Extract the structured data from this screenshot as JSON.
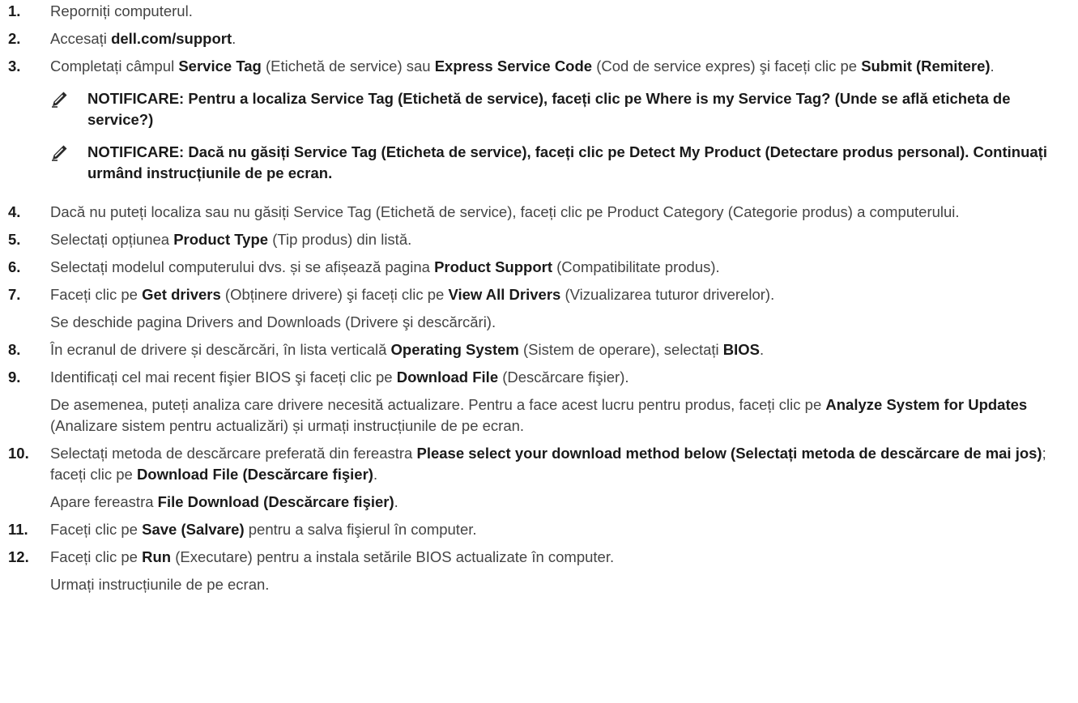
{
  "steps": [
    {
      "num": "1.",
      "parts": [
        {
          "t": "Reporniți computerul."
        }
      ]
    },
    {
      "num": "2.",
      "parts": [
        {
          "t": "Accesați "
        },
        {
          "t": "dell.com/support",
          "b": true
        },
        {
          "t": "."
        }
      ]
    },
    {
      "num": "3.",
      "parts": [
        {
          "t": "Completați câmpul "
        },
        {
          "t": "Service Tag",
          "b": true
        },
        {
          "t": " (Etichetă de service) sau "
        },
        {
          "t": "Express Service Code",
          "b": true
        },
        {
          "t": " (Cod de service expres) şi faceți clic pe "
        },
        {
          "t": "Submit (Remitere)",
          "b": true
        },
        {
          "t": "."
        }
      ],
      "notes": [
        "NOTIFICARE: Pentru a localiza Service Tag (Etichetă de service), faceți clic pe Where is my Service Tag? (Unde se află eticheta de service?)",
        "NOTIFICARE: Dacă nu găsiți Service Tag (Eticheta de service), faceți clic pe Detect My Product (Detectare produs personal). Continuați urmând instrucțiunile de pe ecran."
      ]
    },
    {
      "num": "4.",
      "parts": [
        {
          "t": "Dacă nu puteți localiza sau nu găsiți Service Tag (Etichetă de service), faceți clic pe Product Category (Categorie produs) a computerului."
        }
      ]
    },
    {
      "num": "5.",
      "parts": [
        {
          "t": "Selectați opțiunea "
        },
        {
          "t": "Product Type",
          "b": true
        },
        {
          "t": " (Tip produs) din listă."
        }
      ]
    },
    {
      "num": "6.",
      "parts": [
        {
          "t": "Selectați modelul computerului dvs. și se afișează pagina "
        },
        {
          "t": "Product Support",
          "b": true
        },
        {
          "t": " (Compatibilitate produs)."
        }
      ]
    },
    {
      "num": "7.",
      "parts": [
        {
          "t": "Faceți clic pe "
        },
        {
          "t": "Get drivers",
          "b": true
        },
        {
          "t": " (Obținere drivere) şi faceți clic pe "
        },
        {
          "t": "View All Drivers",
          "b": true
        },
        {
          "t": " (Vizualizarea tuturor driverelor)."
        }
      ],
      "sub": [
        [
          {
            "t": "Se deschide pagina Drivers and Downloads (Drivere şi descărcări)."
          }
        ]
      ]
    },
    {
      "num": "8.",
      "parts": [
        {
          "t": "În ecranul de drivere și descărcări, în lista verticală "
        },
        {
          "t": "Operating System",
          "b": true
        },
        {
          "t": " (Sistem de operare), selectați "
        },
        {
          "t": "BIOS",
          "b": true
        },
        {
          "t": "."
        }
      ]
    },
    {
      "num": "9.",
      "parts": [
        {
          "t": "Identificați cel mai recent fişier BIOS şi faceți clic pe "
        },
        {
          "t": "Download File",
          "b": true
        },
        {
          "t": " (Descărcare fişier)."
        }
      ],
      "sub": [
        [
          {
            "t": "De asemenea, puteți analiza care drivere necesită actualizare. Pentru a face acest lucru pentru produs, faceți clic pe "
          },
          {
            "t": "Analyze System for Updates",
            "b": true
          },
          {
            "t": " (Analizare sistem pentru actualizări) și urmați instrucțiunile de pe ecran."
          }
        ]
      ]
    },
    {
      "num": "10.",
      "parts": [
        {
          "t": "Selectați metoda de descărcare preferată din fereastra "
        },
        {
          "t": "Please select your download method below (Selectați metoda de descărcare de mai jos)",
          "b": true
        },
        {
          "t": "; faceți clic pe "
        },
        {
          "t": "Download File (Descărcare fişier)",
          "b": true
        },
        {
          "t": "."
        }
      ],
      "sub": [
        [
          {
            "t": "Apare fereastra "
          },
          {
            "t": "File Download (Descărcare fişier)",
            "b": true
          },
          {
            "t": "."
          }
        ]
      ]
    },
    {
      "num": "11.",
      "parts": [
        {
          "t": "Faceți clic pe "
        },
        {
          "t": "Save (Salvare)",
          "b": true
        },
        {
          "t": " pentru a salva fişierul în computer."
        }
      ]
    },
    {
      "num": "12.",
      "parts": [
        {
          "t": "Faceți clic pe "
        },
        {
          "t": "Run",
          "b": true
        },
        {
          "t": " (Executare) pentru a instala setările BIOS actualizate în computer."
        }
      ],
      "sub": [
        [
          {
            "t": "Urmați instrucțiunile de pe ecran."
          }
        ]
      ]
    }
  ],
  "note_icon": "pencil-note-icon"
}
